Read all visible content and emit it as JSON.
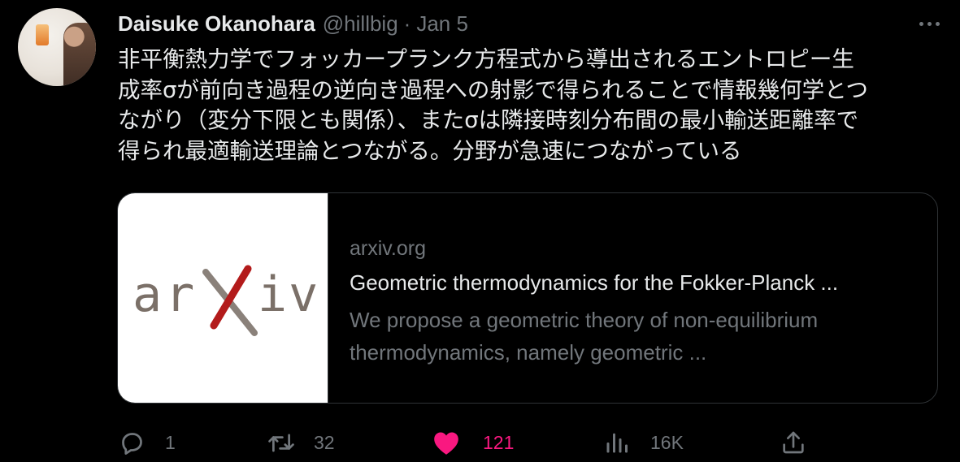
{
  "author": {
    "name": "Daisuke Okanohara",
    "handle": "@hillbig",
    "separator": "·",
    "date": "Jan 5"
  },
  "tweet": {
    "lines": [
      "非平衡熱力学でフォッカープランク方程式から導出されるエントロピー生",
      "成率σが前向き過程の逆向き過程への射影で得られることで情報幾何学とつ",
      "ながり（変分下限とも関係）、またσは隣接時刻分布間の最小輸送距離率で",
      "得られ最適輸送理論とつながる。分野が急速につながっている"
    ]
  },
  "card": {
    "logo_text_left": "ar",
    "logo_text_right": "iv",
    "domain": "arxiv.org",
    "title": "Geometric thermodynamics for the Fokker-Planck ...",
    "description_lines": [
      "We propose a geometric theory of non-equilibrium",
      "thermodynamics, namely geometric ..."
    ],
    "logo_colors": {
      "text": "#7b7068",
      "x_red": "#b31b1b",
      "x_gray": "#8a817a"
    }
  },
  "actions": {
    "reply_count": "1",
    "retweet_count": "32",
    "like_count": "121",
    "views_count": "16K",
    "icons": [
      "reply-icon",
      "retweet-icon",
      "heart-icon",
      "views-icon",
      "share-icon"
    ],
    "colors": {
      "muted": "#71767b",
      "like": "#f91880"
    }
  }
}
